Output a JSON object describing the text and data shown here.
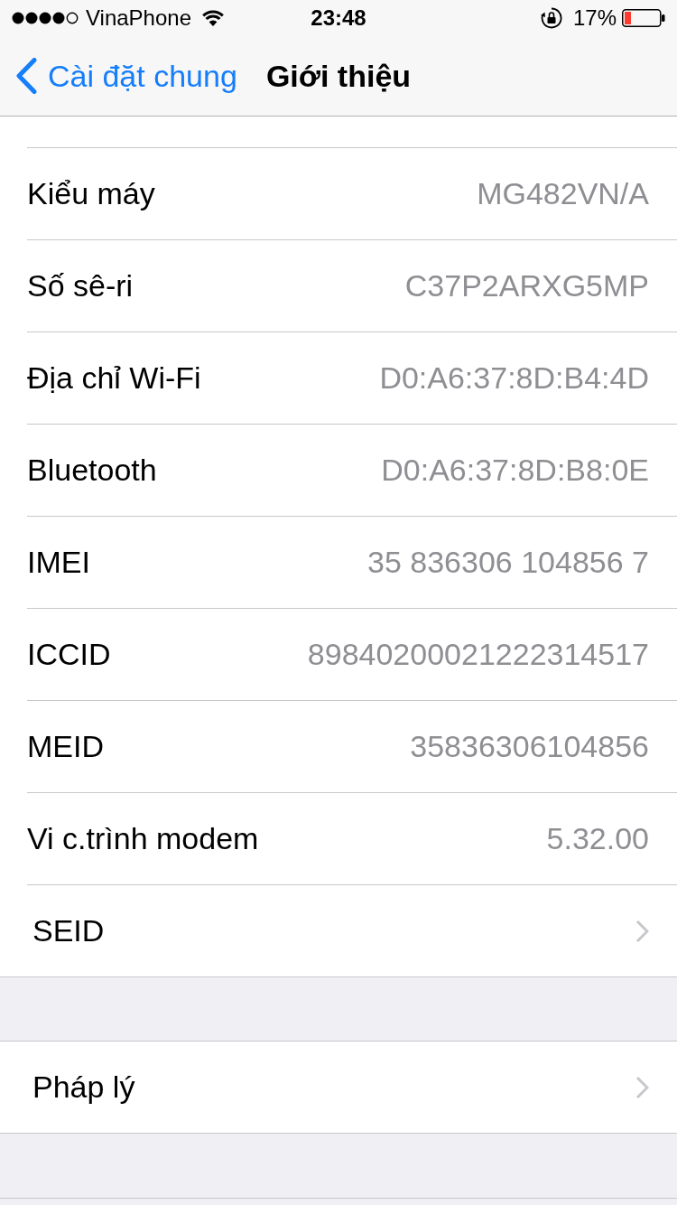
{
  "status_bar": {
    "carrier": "VinaPhone",
    "time": "23:48",
    "battery": "17%"
  },
  "nav_bar": {
    "back": "Cài đặt chung",
    "title": "Giới thiệu"
  },
  "sections": [
    {
      "rows": [
        {
          "kind": "value",
          "label": "Kiểu máy",
          "value": "MG482VN/A"
        },
        {
          "kind": "value",
          "label": "Số sê-ri",
          "value": "C37P2ARXG5MP"
        },
        {
          "kind": "value",
          "label": "Địa chỉ Wi-Fi",
          "value": "D0:A6:37:8D:B4:4D"
        },
        {
          "kind": "value",
          "label": "Bluetooth",
          "value": "D0:A6:37:8D:B8:0E"
        },
        {
          "kind": "value",
          "label": "IMEI",
          "value": "35 836306 104856 7"
        },
        {
          "kind": "value",
          "label": "ICCID",
          "value": "89840200021222314517"
        },
        {
          "kind": "value",
          "label": "MEID",
          "value": "35836306104856"
        },
        {
          "kind": "value",
          "label": "Vi c.trình modem",
          "value": "5.32.00"
        },
        {
          "kind": "disclosure",
          "label": "SEID"
        }
      ]
    },
    {
      "rows": [
        {
          "kind": "disclosure",
          "label": "Pháp lý"
        }
      ]
    }
  ]
}
